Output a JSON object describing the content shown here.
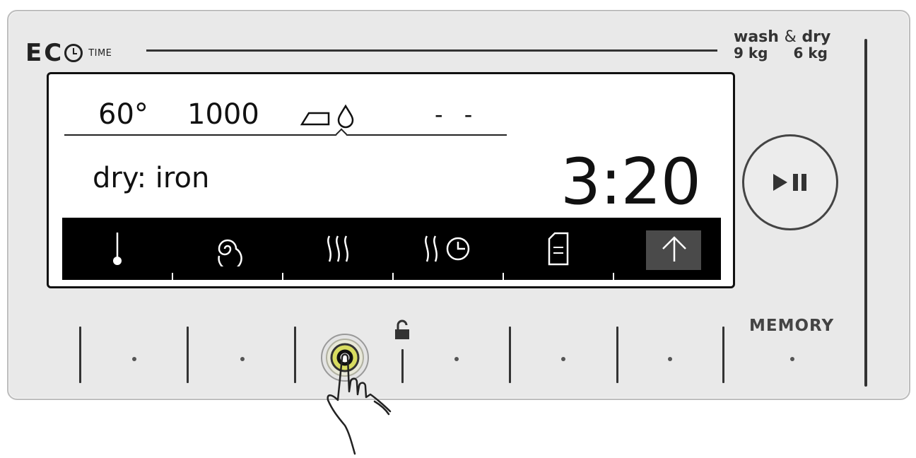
{
  "brand": {
    "logo_letters_e": "E",
    "logo_letters_c": "C",
    "logo_suffix": "TIME"
  },
  "capacity": {
    "title_wash": "wash",
    "title_amp": "&",
    "title_dry": "dry",
    "wash_kg": "9 kg",
    "dry_kg": "6 kg"
  },
  "display": {
    "temperature": "60°",
    "spin_speed": "1000",
    "dry_level_icon": "iron-drop-icon",
    "extra_option": "- -",
    "program_name": "dry: iron",
    "time_remaining": "3:20",
    "menu_icons": [
      {
        "name": "temperature-icon",
        "selected": false
      },
      {
        "name": "spin-icon",
        "selected": false
      },
      {
        "name": "dry-icon",
        "selected": false
      },
      {
        "name": "dry-time-icon",
        "selected": false
      },
      {
        "name": "options-icon",
        "selected": false
      },
      {
        "name": "up-arrow-icon",
        "selected": true
      }
    ]
  },
  "controls": {
    "start_pause_icon": "play-pause-icon",
    "memory_label": "MEMORY",
    "child_lock_icon": "lock-icon",
    "touch_hint_icon": "hand-pointer-icon",
    "active_button_index": 3
  },
  "colors": {
    "panel": "#e9e9e9",
    "display_bg": "#ffffff",
    "iconbar_bg": "#000000",
    "text": "#111111"
  }
}
